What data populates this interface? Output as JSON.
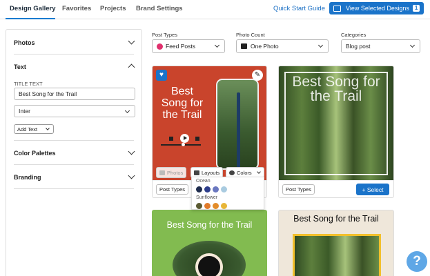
{
  "nav": {
    "tabs": [
      "Design Gallery",
      "Favorites",
      "Projects",
      "Brand Settings"
    ],
    "quick_start": "Quick Start Guide",
    "view_selected": "View Selected Designs",
    "selected_count": "1"
  },
  "left_panel": {
    "photos": "Photos",
    "text": "Text",
    "title_text_label": "TITLE TEXT",
    "title_text_value": "Best Song for the Trail",
    "font": "Inter",
    "add_text": "Add Text",
    "color_palettes": "Color Palettes",
    "branding": "Branding"
  },
  "filters": {
    "post_types_label": "Post Types",
    "post_types_value": "Feed Posts",
    "photo_count_label": "Photo Count",
    "photo_count_value": "One Photo",
    "categories_label": "Categories",
    "categories_value": "Blog post"
  },
  "cards": {
    "card1_title": "Best Song for the Trail",
    "card2_title": "Best Song for the Trail",
    "card3_title": "Best Song for the Trail",
    "card4_title": "Best Song for the Trail",
    "photos_btn": "Photos",
    "layouts_btn": "Layouts",
    "colors_btn": "Colors",
    "post_types_btn": "Post Types",
    "select_btn": "+ Select"
  },
  "palettes": [
    {
      "name": "Ocean",
      "colors": [
        "#1f2d4e",
        "#2e3f8c",
        "#6b78c0",
        "#a9cbe0"
      ]
    },
    {
      "name": "Sunflower",
      "colors": [
        "#5a5a32",
        "#e07a2a",
        "#e38c2a",
        "#e8b638"
      ]
    }
  ],
  "help": "?"
}
